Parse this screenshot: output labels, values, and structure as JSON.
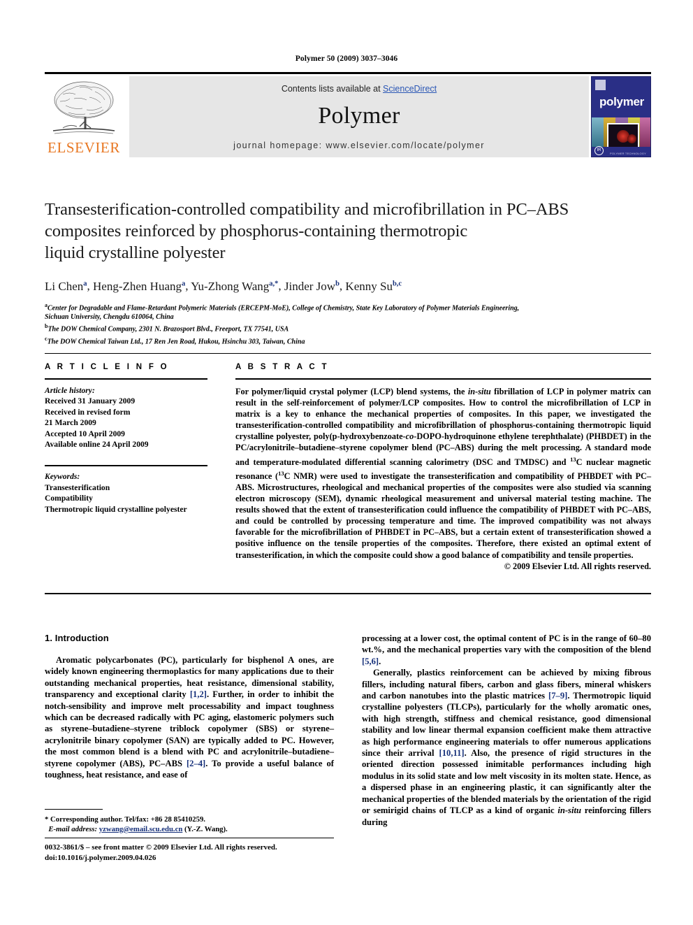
{
  "running_head": "Polymer 50 (2009) 3037–3046",
  "masthead": {
    "contents_prefix": "Contents lists available at ",
    "sciencedirect": "ScienceDirect",
    "journal_name": "Polymer",
    "homepage": "journal homepage: www.elsevier.com/locate/polymer",
    "publisher_logo_text": "ELSEVIER",
    "cover_title": "polymer",
    "cover_badge": "IR",
    "cover_footer_text": "POLYMER TECHNOLOGY",
    "link_color": "#2b57b5",
    "band_color": "#e6e6e6",
    "elsevier_orange": "#E87722",
    "cover_blue": "#2a2f86"
  },
  "article": {
    "title": "Transesterification-controlled compatibility and microfibrillation in PC–ABS composites reinforced by phosphorus-containing thermotropic liquid crystalline polyester",
    "title_lines": [
      "Transesterification-controlled compatibility and microfibrillation in PC–ABS",
      "composites reinforced by phosphorus-containing thermotropic",
      "liquid crystalline polyester"
    ],
    "authors": [
      {
        "name": "Li Chen",
        "marks": "a"
      },
      {
        "name": "Heng-Zhen Huang",
        "marks": "a"
      },
      {
        "name": "Yu-Zhong Wang",
        "marks": "a,*"
      },
      {
        "name": "Jinder Jow",
        "marks": "b"
      },
      {
        "name": "Kenny Su",
        "marks": "b,c"
      }
    ],
    "affiliations": [
      {
        "mark": "a",
        "lines": [
          "Center for Degradable and Flame-Retardant Polymeric Materials (ERCEPM-MoE), College of Chemistry, State Key Laboratory of Polymer Materials Engineering,",
          "Sichuan University, Chengdu 610064, China"
        ]
      },
      {
        "mark": "b",
        "lines": [
          "The DOW Chemical Company, 2301 N. Brazosport Blvd., Freeport, TX 77541, USA"
        ]
      },
      {
        "mark": "c",
        "lines": [
          "The DOW Chemical Taiwan Ltd., 17 Ren Jen Road, Hukou, Hsinchu 303, Taiwan, China"
        ]
      }
    ]
  },
  "article_info": {
    "heading": "A R T I C L E   I N F O",
    "history_label": "Article history:",
    "history": [
      "Received 31 January 2009",
      "Received in revised form",
      "21 March 2009",
      "Accepted 10 April 2009",
      "Available online 24 April 2009"
    ],
    "keywords_label": "Keywords:",
    "keywords": [
      "Transesterification",
      "Compatibility",
      "Thermotropic liquid crystalline polyester"
    ]
  },
  "abstract": {
    "heading": "A B S T R A C T",
    "paragraphs": [
      "For polymer/liquid crystal polymer (LCP) blend systems, the <i>in-situ</i> fibrillation of LCP in polymer matrix can result in the self-reinforcement of polymer/LCP composites. How to control the microfibrillation of LCP in matrix is a key to enhance the mechanical properties of composites. In this paper, we investigated the transesterification-controlled compatibility and microfibrillation of phosphorus-containing thermotropic liquid crystalline polyester, poly(p-hydroxybenzoate-<i>co</i>-DOPO-hydroquinone ethylene terephthalate) (PHBDET) in the PC/acrylonitrile–butadiene–styrene copolymer blend (PC–ABS) during the melt processing. A standard mode and temperature-modulated differential scanning calorimetry (DSC and TMDSC) and <sup>13</sup>C nuclear magnetic resonance (<sup>13</sup>C NMR) were used to investigate the transesterification and compatibility of PHBDET with PC–ABS. Microstructures, rheological and mechanical properties of the composites were also studied via scanning electron microscopy (SEM), dynamic rheological measurement and universal material testing machine. The results showed that the extent of transesterification could influence the compatibility of PHBDET with PC–ABS, and could be controlled by processing temperature and time. The improved compatibility was not always favorable for the microfibrillation of PHBDET in PC–ABS, but a certain extent of transesterification showed a positive influence on the tensile properties of the composites. Therefore, there existed an optimal extent of transesterification, in which the composite could show a good balance of compatibility and tensile properties."
    ],
    "copyright": "© 2009 Elsevier Ltd. All rights reserved."
  },
  "body": {
    "section_number_title": "1.  Introduction",
    "left_paragraphs": [
      "Aromatic polycarbonates (PC), particularly for bisphenol A ones, are widely known engineering thermoplastics for many applications due to their outstanding mechanical properties, heat resistance, dimensional stability, transparency and exceptional clarity <span class=\"ref\">[1,2]</span>. Further, in order to inhibit the notch-sensibility and improve melt processability and impact toughness which can be decreased radically with PC aging, elastomeric polymers such as styrene–butadiene–styrene triblock copolymer (SBS) or styrene–acrylonitrile binary copolymer (SAN) are typically added to PC. However, the most common blend is a blend with PC and acrylonitrile–butadiene–styrene copolymer (ABS), PC–ABS <span class=\"ref\">[2–4]</span>. To provide a useful balance of toughness, heat resistance, and ease of"
    ],
    "right_paragraphs": [
      "processing at a lower cost, the optimal content of PC is in the range of 60–80 wt.%, and the mechanical properties vary with the composition of the blend <span class=\"ref\">[5,6]</span>.",
      "Generally, plastics reinforcement can be achieved by mixing fibrous fillers, including natural fibers, carbon and glass fibers, mineral whiskers and carbon nanotubes into the plastic matrices <span class=\"ref\">[7–9]</span>. Thermotropic liquid crystalline polyesters (TLCPs), particularly for the wholly aromatic ones, with high strength, stiffness and chemical resistance, good dimensional stability and low linear thermal expansion coefficient make them attractive as high performance engineering materials to offer numerous applications since their arrival <span class=\"ref\">[10,11]</span>. Also, the presence of rigid structures in the oriented direction possessed inimitable performances including high modulus in its solid state and low melt viscosity in its molten state. Hence, as a dispersed phase in an engineering plastic, it can significantly alter the mechanical properties of the blended materials by the orientation of the rigid or semirigid chains of TLCP as a kind of organic <i>in-situ</i> reinforcing fillers during"
    ]
  },
  "footnote": {
    "corresponding": "* Corresponding author. Tel/fax: +86 28 85410259.",
    "email_label": "E-mail address:",
    "email": "yzwang@email.scu.edu.cn",
    "email_suffix": "(Y.-Z. Wang)."
  },
  "bottom": {
    "issn_line": "0032-3861/$ – see front matter © 2009 Elsevier Ltd. All rights reserved.",
    "doi_line": "doi:10.1016/j.polymer.2009.04.026"
  }
}
